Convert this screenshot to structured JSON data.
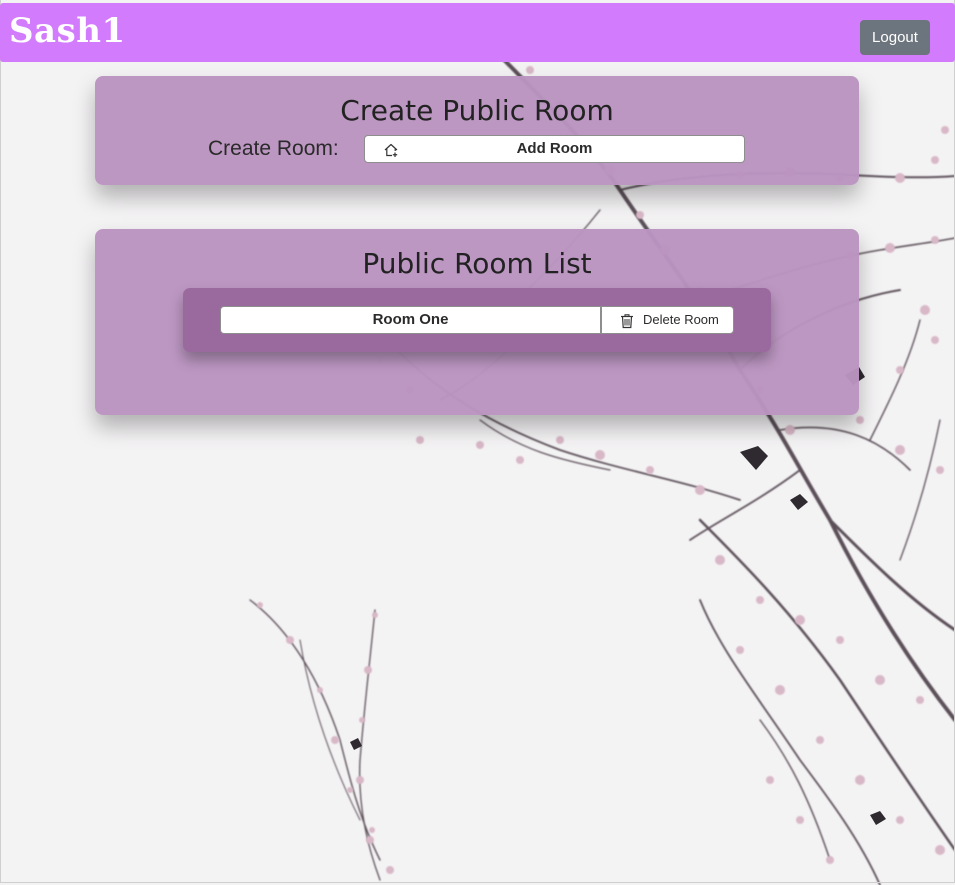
{
  "navbar": {
    "brand": "Sash1",
    "logout_label": "Logout",
    "color": "#d27cfd"
  },
  "create_card": {
    "title": "Create Public Room",
    "label": "Create Room:",
    "add_button": {
      "label": "Add Room",
      "icon": "house-add-icon"
    }
  },
  "list_card": {
    "title": "Public Room List",
    "rooms": [
      {
        "name": "Room One",
        "delete_label": "Delete Room",
        "delete_icon": "trash-icon"
      }
    ]
  },
  "colors": {
    "card": "#ba94c0",
    "room_list": "#9a6a9f",
    "logout": "#6c757d"
  },
  "background": "cherry-blossom-branches"
}
